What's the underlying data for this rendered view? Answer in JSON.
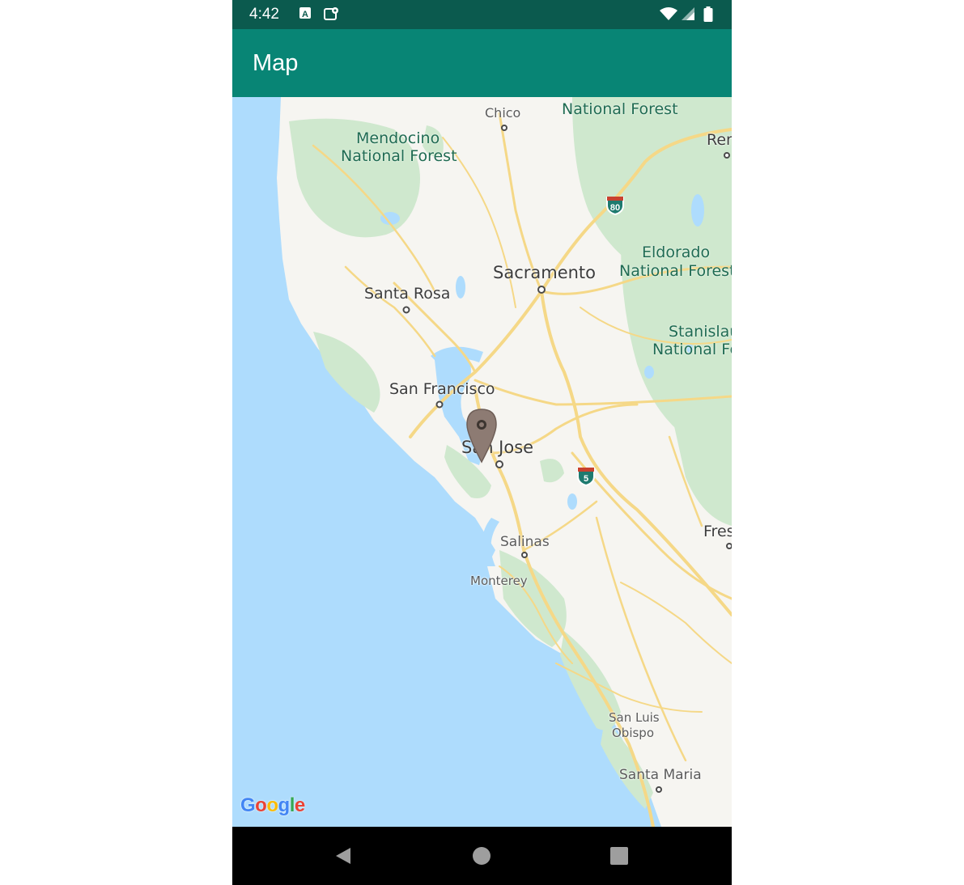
{
  "status_bar": {
    "time": "4:42",
    "icons": [
      "a-icon",
      "location-settings-icon",
      "wifi-icon",
      "signal-icon",
      "battery-icon"
    ]
  },
  "app_bar": {
    "title": "Map"
  },
  "map": {
    "provider": "Google",
    "water_color": "#aedcfd",
    "land_color": "#f6f5f1",
    "park_color": "#cfe8ce",
    "road_color": "#f5d887",
    "places": {
      "chico": "Chico",
      "reno": "Reno",
      "sacramento": "Sacramento",
      "santa_rosa": "Santa Rosa",
      "san_francisco": "San Francisco",
      "san_jose": "San Jose",
      "fresno": "Fres",
      "salinas": "Salinas",
      "monterey": "Monterey",
      "san_luis_obispo_1": "San Luis",
      "san_luis_obispo_2": "Obispo",
      "santa_maria": "Santa Maria"
    },
    "parks": {
      "national_forest_top": "National Forest",
      "mendocino_1": "Mendocino",
      "mendocino_2": "National Forest",
      "eldorado_1": "Eldorado",
      "eldorado_2": "National Forest",
      "stanislaus_1": "Stanislau",
      "stanislaus_2": "National Fo"
    },
    "shields": {
      "i80": "80",
      "i5": "5"
    },
    "marker": {
      "name": "selected-location-marker",
      "color": "#8d7b73"
    }
  },
  "nav_bar": {
    "icons": [
      "back-icon",
      "home-icon",
      "recents-icon"
    ]
  }
}
